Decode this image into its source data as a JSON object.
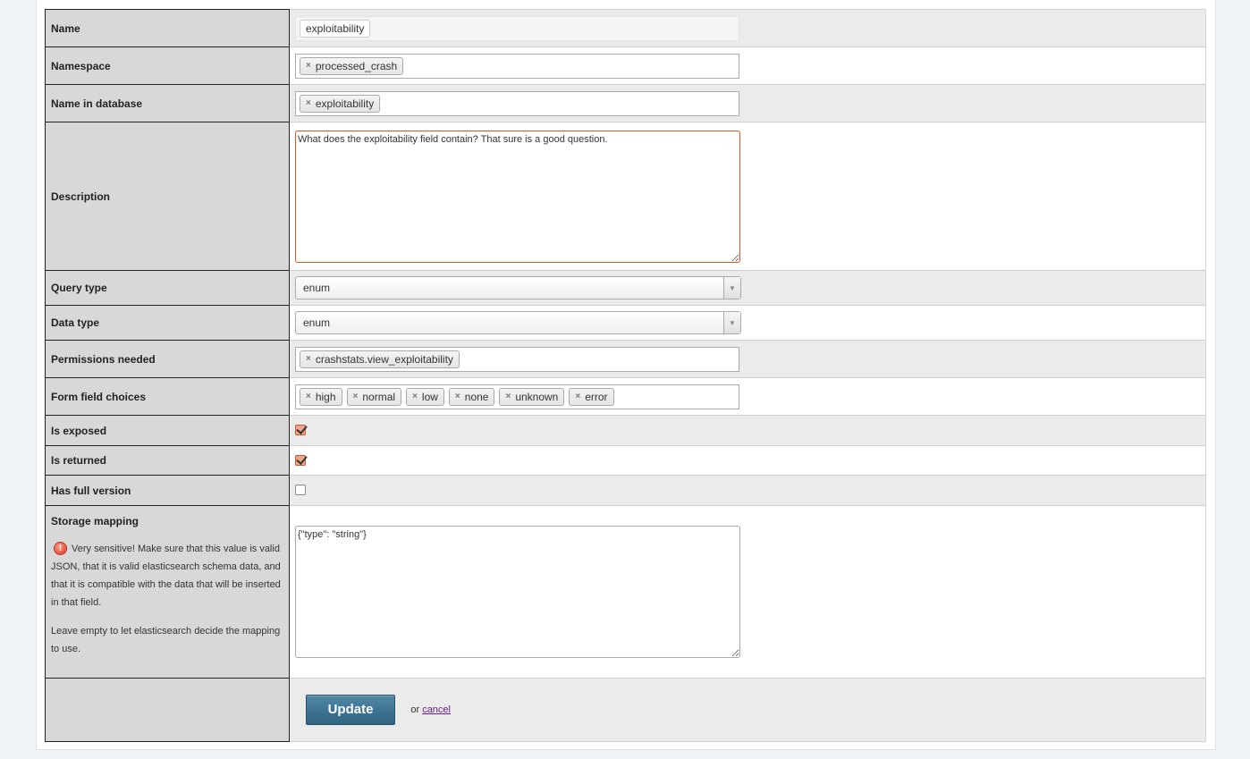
{
  "fields": {
    "name": {
      "label": "Name",
      "value": "exploitability"
    },
    "namespace": {
      "label": "Namespace",
      "value": "processed_crash"
    },
    "name_in_database": {
      "label": "Name in database",
      "value": "exploitability"
    },
    "description": {
      "label": "Description",
      "value": "What does the exploitability field contain? That sure is a good question."
    },
    "query_type": {
      "label": "Query type",
      "value": "enum"
    },
    "data_type": {
      "label": "Data type",
      "value": "enum"
    },
    "permissions_needed": {
      "label": "Permissions needed",
      "tags": [
        "crashstats.view_exploitability"
      ]
    },
    "form_field_choices": {
      "label": "Form field choices",
      "tags": [
        "high",
        "normal",
        "low",
        "none",
        "unknown",
        "error"
      ]
    },
    "is_exposed": {
      "label": "Is exposed",
      "checked": true
    },
    "is_returned": {
      "label": "Is returned",
      "checked": true
    },
    "has_full_version": {
      "label": "Has full version",
      "checked": false
    },
    "storage_mapping": {
      "label": "Storage mapping",
      "warning": "Very sensitive! Make sure that this value is valid JSON, that it is valid elasticsearch schema data, and that it is compatible with the data that will be inserted in that field.",
      "help": "Leave empty to let elasticsearch decide the mapping to use.",
      "value": "{\"type\": \"string\"}"
    }
  },
  "actions": {
    "update_label": "Update",
    "or_text": "or",
    "cancel_label": "cancel"
  },
  "icons": {
    "tag_remove": "×",
    "dropdown": "▼",
    "warning": "!"
  },
  "colors": {
    "header_bg": "#d8d8d8",
    "alt_row_bg": "#ebebeb",
    "focus_border": "#d9532b",
    "button_bg": "#2f6381",
    "link": "#6a1b8a"
  }
}
